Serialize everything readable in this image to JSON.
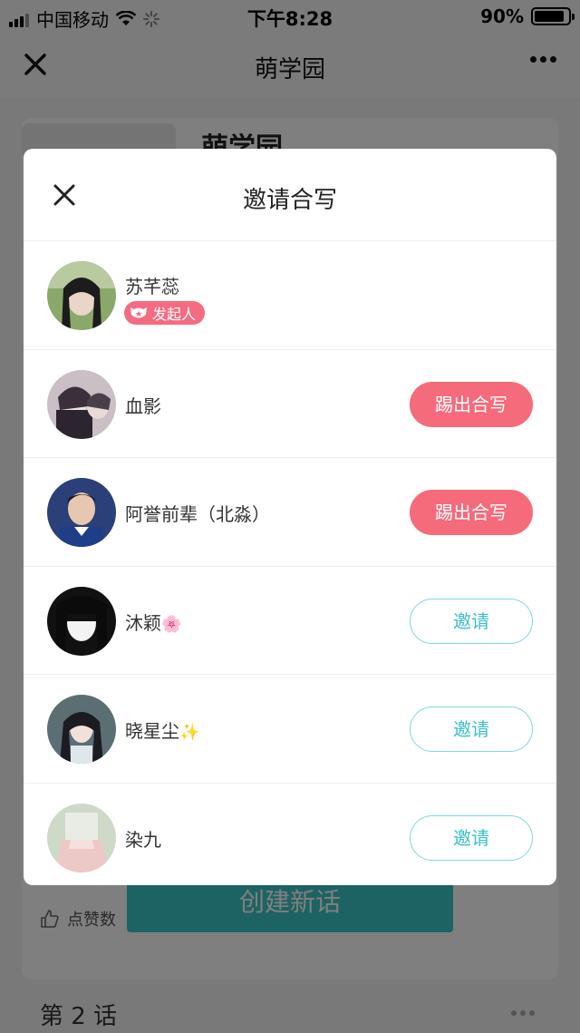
{
  "status_bar": {
    "carrier": "中国移动",
    "time": "下午8:28",
    "battery_percent": "90%",
    "battery_level": 0.9
  },
  "nav": {
    "title": "萌学园"
  },
  "background": {
    "book_title": "萌学园",
    "like_label": "点赞数",
    "create_button": "创建新话",
    "episode_label": "第 2 话"
  },
  "modal": {
    "title": "邀请合写",
    "members": [
      {
        "name": "苏芊蕊",
        "badge": "发起人",
        "action": ""
      },
      {
        "name": "血影",
        "action": "踢出合写"
      },
      {
        "name": "阿誉前辈（北淼）",
        "action": "踢出合写"
      },
      {
        "name": "沐颖",
        "emoji": "🌸",
        "action": "邀请"
      },
      {
        "name": "晓星尘",
        "emoji": "✨",
        "action": "邀请"
      },
      {
        "name": "染九",
        "action": "邀请"
      }
    ]
  },
  "colors": {
    "accent_pink": "#f56b7b",
    "accent_teal": "#3cbfc9",
    "overlay": "rgba(0,0,0,0.5)"
  }
}
